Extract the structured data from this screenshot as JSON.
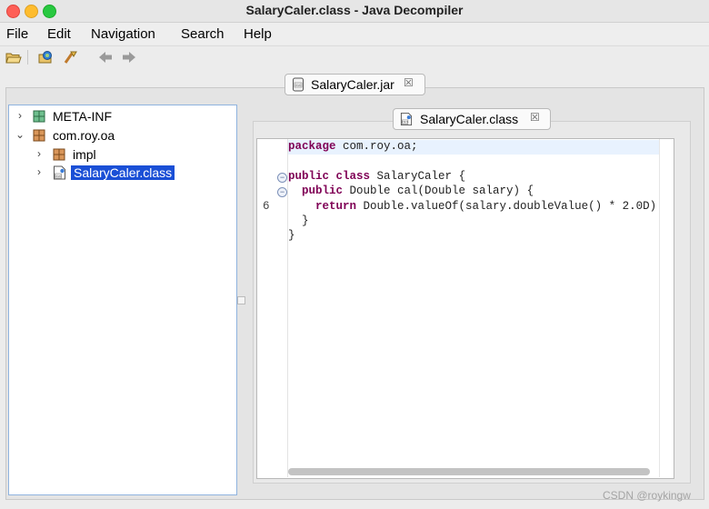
{
  "window": {
    "title": "SalaryCaler.class - Java Decompiler"
  },
  "menu": [
    {
      "label": "File"
    },
    {
      "label": "Edit"
    },
    {
      "label": "Navigation"
    },
    {
      "label": "Search"
    },
    {
      "label": "Help"
    }
  ],
  "toolbar": {
    "buttons": [
      "open-file-icon",
      "open-type-icon",
      "search-icon",
      "back-arrow-icon",
      "forward-arrow-icon"
    ]
  },
  "outer_tab": {
    "label": "SalaryCaler.jar",
    "close": "☒"
  },
  "tree": [
    {
      "label": "META-INF",
      "icon": "package-icon",
      "expanded": false
    },
    {
      "label": "com.roy.oa",
      "icon": "package-icon",
      "expanded": true
    },
    {
      "label": "impl",
      "icon": "package-icon",
      "expanded": false
    },
    {
      "label": "SalaryCaler.class",
      "icon": "class-file-icon",
      "expanded": false,
      "selected": true
    }
  ],
  "editor_tab": {
    "label": "SalaryCaler.class",
    "close": "☒"
  },
  "code": {
    "l1_kw": "package",
    "l1_rest": " com.roy.oa;",
    "l3_kw1": "public",
    "l3_kw2": "class",
    "l3_rest": " SalaryCaler {",
    "l4_kw": "public",
    "l4_rest": " Double cal(Double salary) {",
    "l5_kw": "return",
    "l5_rest": " Double.valueOf(salary.doubleValue() * 2.0D)",
    "l6": "}",
    "l7": "}",
    "line_number": "6"
  },
  "watermark": "CSDN @roykingw"
}
